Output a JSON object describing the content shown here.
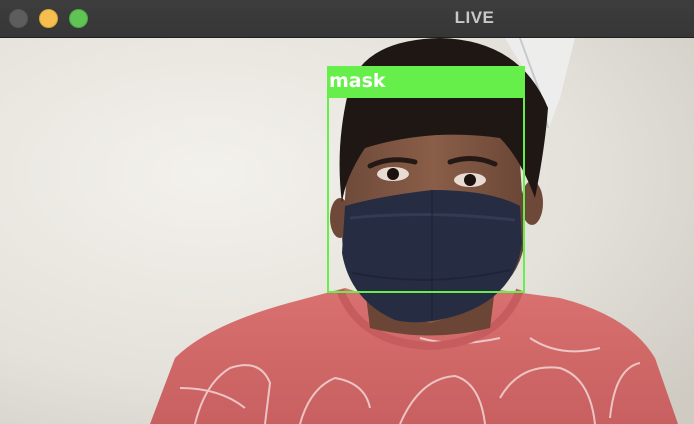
{
  "window": {
    "title": "LIVE",
    "controls": [
      "close",
      "minimize",
      "zoom"
    ]
  },
  "detection": {
    "label": "mask",
    "color": "#66ee4a"
  },
  "colors": {
    "titlebar": "#3a3a3a",
    "close": "#5d5d5d",
    "minimize": "#f5be4f",
    "zoom": "#5fc454",
    "shirt": "#d86f6d",
    "mask": "#252b40",
    "wall": "#e6e4df"
  }
}
